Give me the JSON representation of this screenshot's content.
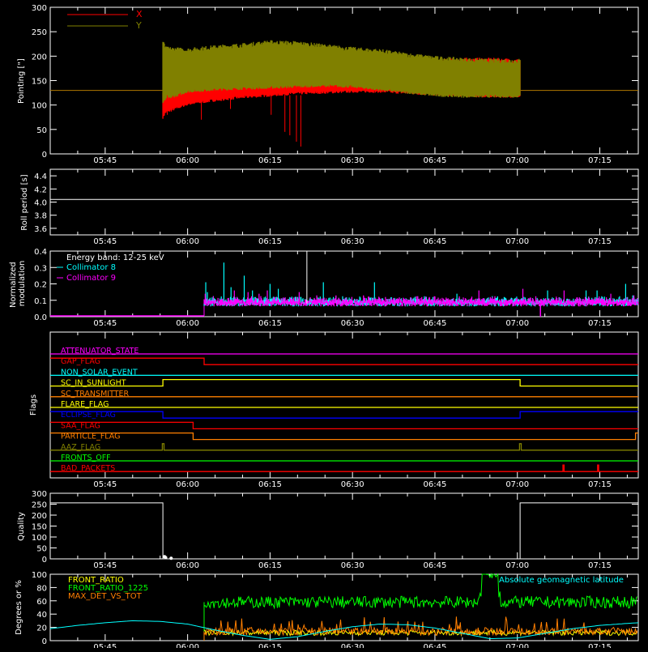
{
  "time_axis": {
    "ticks": [
      "05:45",
      "06:00",
      "06:15",
      "06:30",
      "06:45",
      "07:00",
      "07:15"
    ],
    "tick_minutes": [
      345,
      360,
      375,
      390,
      405,
      420,
      435
    ],
    "range_minutes": [
      335,
      442
    ],
    "minor_step_minutes": 5
  },
  "chart_data": [
    {
      "id": "pointing",
      "type": "line",
      "ylabel": "Pointing [\"]",
      "ylim": [
        0,
        300
      ],
      "yticks": [
        0,
        50,
        100,
        150,
        200,
        250,
        300
      ],
      "legend_position": "top-left",
      "reference_line": 130,
      "reference_color": "#b07800",
      "series": [
        {
          "name": "X",
          "color": "#ff0000",
          "t": [
            355.5,
            356,
            360,
            365,
            370,
            375,
            380,
            385,
            390,
            395,
            400,
            405,
            410,
            415,
            420.5
          ],
          "low": [
            75,
            85,
            102,
            110,
            116,
            120,
            124,
            126,
            128,
            128,
            125,
            122,
            120,
            118,
            118
          ],
          "high": [
            130,
            140,
            152,
            156,
            158,
            158,
            160,
            162,
            166,
            172,
            180,
            188,
            192,
            192,
            190
          ]
        },
        {
          "name": "Y",
          "color": "#808000",
          "t": [
            355.5,
            356,
            360,
            365,
            370,
            375,
            380,
            385,
            390,
            395,
            400,
            405,
            410,
            415,
            420.5
          ],
          "low": [
            105,
            112,
            128,
            132,
            134,
            136,
            138,
            140,
            138,
            132,
            126,
            120,
            118,
            118,
            118
          ],
          "high": [
            230,
            215,
            212,
            218,
            222,
            228,
            226,
            220,
            214,
            210,
            202,
            196,
            192,
            190,
            190
          ]
        }
      ],
      "dips": [
        {
          "t": 356.3,
          "y": 80
        },
        {
          "t": 362.5,
          "y": 70
        },
        {
          "t": 367.8,
          "y": 92
        },
        {
          "t": 375.2,
          "y": 80
        },
        {
          "t": 377.7,
          "y": 45
        },
        {
          "t": 378.6,
          "y": 38
        },
        {
          "t": 379.8,
          "y": 25
        },
        {
          "t": 380.6,
          "y": 15
        }
      ]
    },
    {
      "id": "roll",
      "type": "line",
      "ylabel": "Roll period [s]",
      "ylim": [
        3.5,
        4.5
      ],
      "yticks": [
        3.6,
        3.8,
        4.0,
        4.2,
        4.4
      ],
      "series": [
        {
          "name": "roll",
          "color": "#ffffff",
          "t": [
            335,
            442
          ],
          "y": [
            4.04,
            4.04
          ]
        }
      ]
    },
    {
      "id": "modulation",
      "type": "line",
      "ylabel": "Normalized\nmodulation",
      "ylim": [
        0,
        0.4
      ],
      "yticks": [
        0.0,
        0.1,
        0.2,
        0.3,
        0.4
      ],
      "legend_position": "top-left",
      "annotation": "Energy band: 12-25 keV",
      "start_minute": 363,
      "baseline": 0.08,
      "series": [
        {
          "name": "Collimator 8",
          "color": "#00ffff",
          "spikes": [
            [
              363.3,
              0.21
            ],
            [
              363.6,
              0.15
            ],
            [
              366.6,
              0.33
            ],
            [
              367.9,
              0.18
            ],
            [
              370.3,
              0.25
            ],
            [
              371.8,
              0.16
            ],
            [
              375.0,
              0.2
            ],
            [
              376.5,
              0.17
            ],
            [
              384.7,
              0.21
            ],
            [
              394.0,
              0.21
            ],
            [
              409.0,
              0.14
            ],
            [
              425.5,
              0.16
            ],
            [
              432.5,
              0.16
            ],
            [
              434.5,
              0.16
            ],
            [
              439.7,
              0.2
            ],
            [
              441.0,
              0.13
            ]
          ]
        },
        {
          "name": "Collimator 9",
          "color": "#ff00ff",
          "spikes": [
            [
              363.2,
              0.14
            ],
            [
              363.8,
              0.1
            ],
            [
              368.5,
              0.16
            ],
            [
              371.0,
              0.15
            ],
            [
              373.0,
              0.14
            ],
            [
              374.5,
              0.16
            ],
            [
              380.3,
              0.15
            ],
            [
              383.5,
              0.13
            ],
            [
              387.0,
              0.13
            ],
            [
              392.0,
              0.13
            ],
            [
              396.0,
              0.12
            ],
            [
              404.0,
              0.12
            ],
            [
              413.0,
              0.16
            ],
            [
              421.0,
              0.17
            ],
            [
              428.5,
              0.16
            ],
            [
              433.0,
              0.12
            ],
            [
              437.0,
              0.14
            ],
            [
              441.2,
              0.13
            ]
          ],
          "dips": [
            [
              424.2,
              0.0
            ]
          ]
        }
      ],
      "spike_extra": {
        "t": 381.7,
        "y": 0.4,
        "color": "#ffffff"
      }
    },
    {
      "id": "flags",
      "type": "line",
      "ylabel": "Flags",
      "series": [
        {
          "name": "ATTENUATOR_STATE",
          "color": "#ff00ff",
          "steps": [
            [
              335,
              0
            ],
            [
              442,
              0
            ]
          ]
        },
        {
          "name": "GAP_FLAG",
          "color": "#ff0000",
          "steps": [
            [
              335,
              1
            ],
            [
              363,
              1
            ],
            [
              363,
              0
            ],
            [
              442,
              0
            ]
          ]
        },
        {
          "name": "NON_SOLAR_EVENT",
          "color": "#00ffff",
          "steps": [
            [
              335,
              0
            ],
            [
              442,
              0
            ]
          ]
        },
        {
          "name": "SC_IN_SUNLIGHT",
          "color": "#ffff00",
          "steps": [
            [
              335,
              0
            ],
            [
              355.5,
              0
            ],
            [
              355.5,
              1
            ],
            [
              420.5,
              1
            ],
            [
              420.5,
              0
            ],
            [
              442,
              0
            ]
          ]
        },
        {
          "name": "SC_TRANSMITTER",
          "color": "#ff7f00",
          "steps": [
            [
              335,
              0
            ],
            [
              442,
              0
            ]
          ]
        },
        {
          "name": "FLARE_FLAG",
          "color": "#ffff00",
          "steps": [
            [
              335,
              0
            ],
            [
              442,
              0
            ]
          ]
        },
        {
          "name": "ECLIPSE_FLAG",
          "color": "#0000ff",
          "steps": [
            [
              335,
              1
            ],
            [
              355.5,
              1
            ],
            [
              355.5,
              0
            ],
            [
              420.5,
              0
            ],
            [
              420.5,
              1
            ],
            [
              442,
              1
            ]
          ]
        },
        {
          "name": "SAA_FLAG",
          "color": "#ff0000",
          "steps": [
            [
              335,
              1
            ],
            [
              361,
              1
            ],
            [
              361,
              0
            ],
            [
              442,
              0
            ]
          ]
        },
        {
          "name": "PARTICLE_FLAG",
          "color": "#ff7f00",
          "steps": [
            [
              335,
              1
            ],
            [
              361,
              1
            ],
            [
              361,
              0
            ],
            [
              441.5,
              0
            ],
            [
              441.5,
              1
            ],
            [
              442,
              1
            ]
          ]
        },
        {
          "name": "AAZ_FLAG",
          "color": "#808000",
          "steps": [
            [
              335,
              0
            ],
            [
              355.4,
              0
            ],
            [
              355.4,
              1
            ],
            [
              355.7,
              1
            ],
            [
              355.7,
              0
            ],
            [
              420.4,
              0
            ],
            [
              420.4,
              1
            ],
            [
              420.7,
              1
            ],
            [
              420.7,
              0
            ],
            [
              442,
              0
            ]
          ]
        },
        {
          "name": "FRONTS_OFF",
          "color": "#00ff00",
          "steps": [
            [
              335,
              0
            ],
            [
              442,
              0
            ]
          ]
        },
        {
          "name": "BAD_PACKETS",
          "color": "#ff0000",
          "steps": [
            [
              335,
              0
            ],
            [
              428.3,
              0
            ],
            [
              428.3,
              1
            ],
            [
              428.5,
              1
            ],
            [
              428.5,
              0
            ],
            [
              434.6,
              0
            ],
            [
              434.6,
              1
            ],
            [
              434.8,
              1
            ],
            [
              434.8,
              0
            ],
            [
              442,
              0
            ]
          ]
        }
      ]
    },
    {
      "id": "quality",
      "type": "line",
      "ylabel": "Quality",
      "ylim": [
        0,
        300
      ],
      "yticks": [
        0,
        50,
        100,
        150,
        200,
        250,
        300
      ],
      "series": [
        {
          "name": "quality",
          "color": "#ffffff",
          "steps": [
            [
              335,
              256
            ],
            [
              355.5,
              256
            ],
            [
              355.5,
              0
            ],
            [
              420.5,
              0
            ],
            [
              420.5,
              256
            ],
            [
              442,
              256
            ]
          ]
        }
      ],
      "dots": [
        [
          355.8,
          10
        ],
        [
          356.0,
          6
        ],
        [
          357.0,
          3
        ]
      ]
    },
    {
      "id": "ratios",
      "type": "line",
      "ylabel": "Degrees or %",
      "ylim": [
        0,
        100
      ],
      "yticks": [
        0,
        20,
        40,
        60,
        80,
        100
      ],
      "legend_position": "top-left",
      "annotation": "Absolute geomagnetic latitude",
      "annotation_color": "#00ffff",
      "series": [
        {
          "name": "FRONT_RATIO",
          "color": "#ffff00",
          "base": 12,
          "noise": 4,
          "start": 363
        },
        {
          "name": "FRONT_RATIO_1225",
          "color": "#00ff00",
          "base": 58,
          "noise": 9,
          "start": 363,
          "bump": [
            [
              414.5,
              95
            ],
            [
              415.5,
              90
            ]
          ]
        },
        {
          "name": "MAX_DET_VS_TOT",
          "color": "#ff7f00",
          "base": 14,
          "noise": 6,
          "start": 363
        },
        {
          "name": "Absolute geomagnetic latitude",
          "color": "#00ffff",
          "t": [
            335,
            340,
            345,
            350,
            355,
            360,
            365,
            370,
            375,
            380,
            385,
            390,
            395,
            400,
            405,
            410,
            415,
            420,
            425,
            430,
            435,
            440,
            442
          ],
          "y": [
            18,
            23,
            27,
            30,
            29,
            25,
            16,
            8,
            2,
            6,
            14,
            21,
            25,
            24,
            19,
            11,
            3,
            4,
            11,
            18,
            23,
            26,
            27
          ]
        }
      ]
    }
  ]
}
